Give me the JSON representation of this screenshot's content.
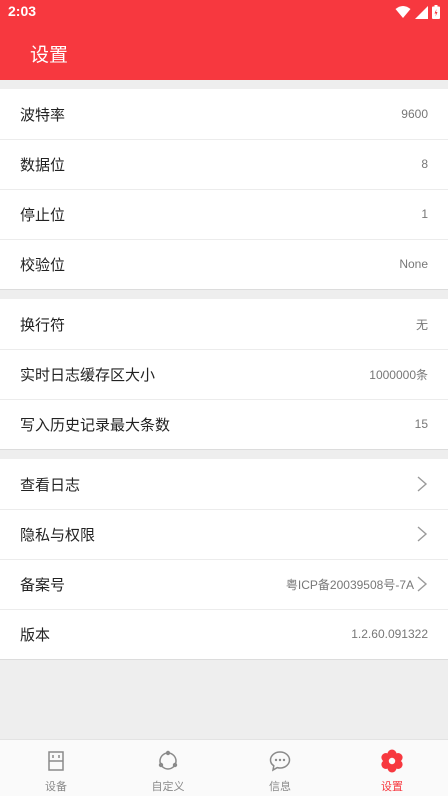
{
  "status": {
    "time": "2:03"
  },
  "appbar": {
    "title": "设置"
  },
  "groups": [
    [
      {
        "label": "波特率",
        "value": "9600"
      },
      {
        "label": "数据位",
        "value": "8"
      },
      {
        "label": "停止位",
        "value": "1"
      },
      {
        "label": "校验位",
        "value": "None"
      }
    ],
    [
      {
        "label": "换行符",
        "value": "无"
      },
      {
        "label": "实时日志缓存区大小",
        "value": "1000000条"
      },
      {
        "label": "写入历史记录最大条数",
        "value": "15"
      }
    ],
    [
      {
        "label": "查看日志",
        "value": ""
      },
      {
        "label": "隐私与权限",
        "value": ""
      },
      {
        "label": "备案号",
        "value": "粤ICP备20039508号-7A"
      },
      {
        "label": "版本",
        "value": "1.2.60.091322"
      }
    ]
  ],
  "tabs": [
    {
      "label": "设备",
      "icon": "device-icon"
    },
    {
      "label": "自定义",
      "icon": "custom-icon"
    },
    {
      "label": "信息",
      "icon": "chat-icon"
    },
    {
      "label": "设置",
      "icon": "settings-icon",
      "active": true
    }
  ],
  "colors": {
    "accent": "#f7383f",
    "inactive": "#8a8a8a"
  }
}
